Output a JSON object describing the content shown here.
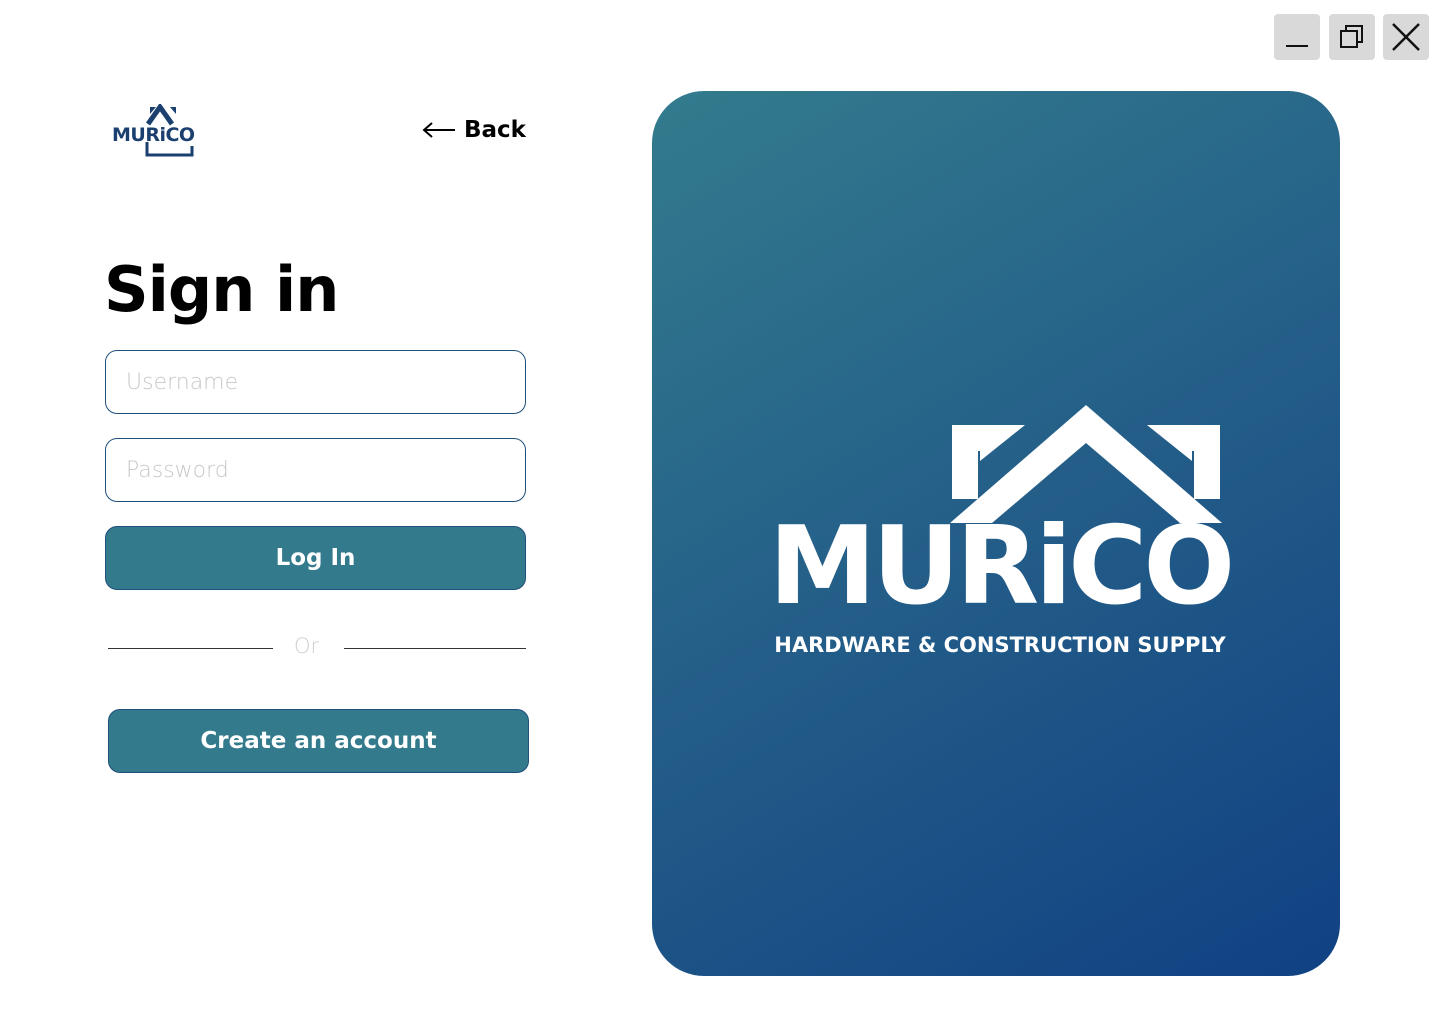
{
  "window_controls": {
    "minimize": "minimize-icon",
    "maximize": "restore-icon",
    "close": "close-icon"
  },
  "header": {
    "logo_text": "MURiCO",
    "back_label": "Back"
  },
  "form": {
    "title": "Sign in",
    "username_placeholder": "Username",
    "username_value": "",
    "password_placeholder": "Password",
    "password_value": "",
    "login_label": "Log In",
    "divider_text": "Or",
    "create_account_label": "Create an account"
  },
  "brand": {
    "name": "MURiCO",
    "tagline": "HARDWARE & CONSTRUCTION SUPPLY"
  },
  "colors": {
    "button_bg": "#327a8c",
    "button_border": "#1f4f7a",
    "logo_navy": "#1b3f6e",
    "panel_gradient_start": "#337b8d",
    "panel_gradient_end": "#104183"
  }
}
